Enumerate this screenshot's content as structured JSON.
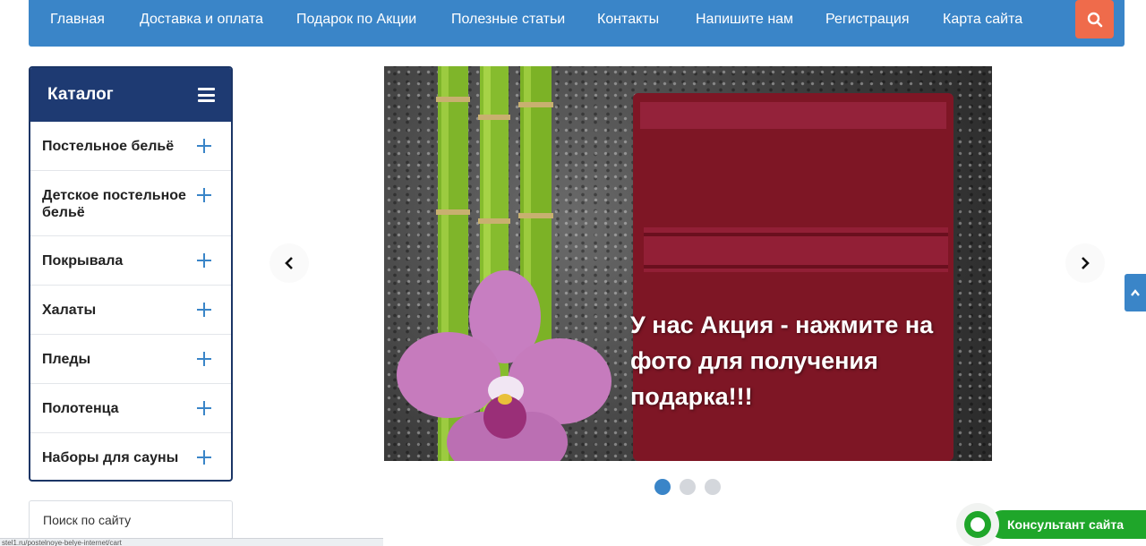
{
  "nav": {
    "items": [
      "Главная",
      "Доставка и оплата",
      "Подарок по Акции",
      "Полезные статьи",
      "Контакты",
      "Напишите нам",
      "Регистрация",
      "Карта сайта"
    ],
    "search_icon": "search-icon"
  },
  "catalog": {
    "title": "Каталог",
    "menu_icon": "hamburger-icon",
    "items": [
      {
        "label": "Постельное бельё"
      },
      {
        "label": "Детское постельное бельё"
      },
      {
        "label": "Покрывала"
      },
      {
        "label": "Халаты"
      },
      {
        "label": "Пледы"
      },
      {
        "label": "Полотенца"
      },
      {
        "label": "Наборы для сауны"
      }
    ],
    "expand_icon": "plus-icon"
  },
  "site_search": {
    "label": "Поиск по сайту"
  },
  "slider": {
    "banner_text": "У нас Акция - нажмите на фото для получения подарка!!!",
    "prev_icon": "chevron-left-icon",
    "next_icon": "chevron-right-icon",
    "slide_count": 3,
    "active_slide": 1
  },
  "consultant": {
    "label": "Консультант сайта",
    "icon": "chat-icon"
  },
  "scroll_top_icon": "chevron-up-icon",
  "status_bar": {
    "url": "stel1.ru/postelnoye-belye-internet/cart"
  },
  "colors": {
    "nav_bg": "#3a85c8",
    "search_btn": "#ef6b4b",
    "catalog_head": "#1e3a72",
    "accent": "#3a85c8",
    "consultant": "#1fa62a",
    "towel": "#7e1625"
  }
}
